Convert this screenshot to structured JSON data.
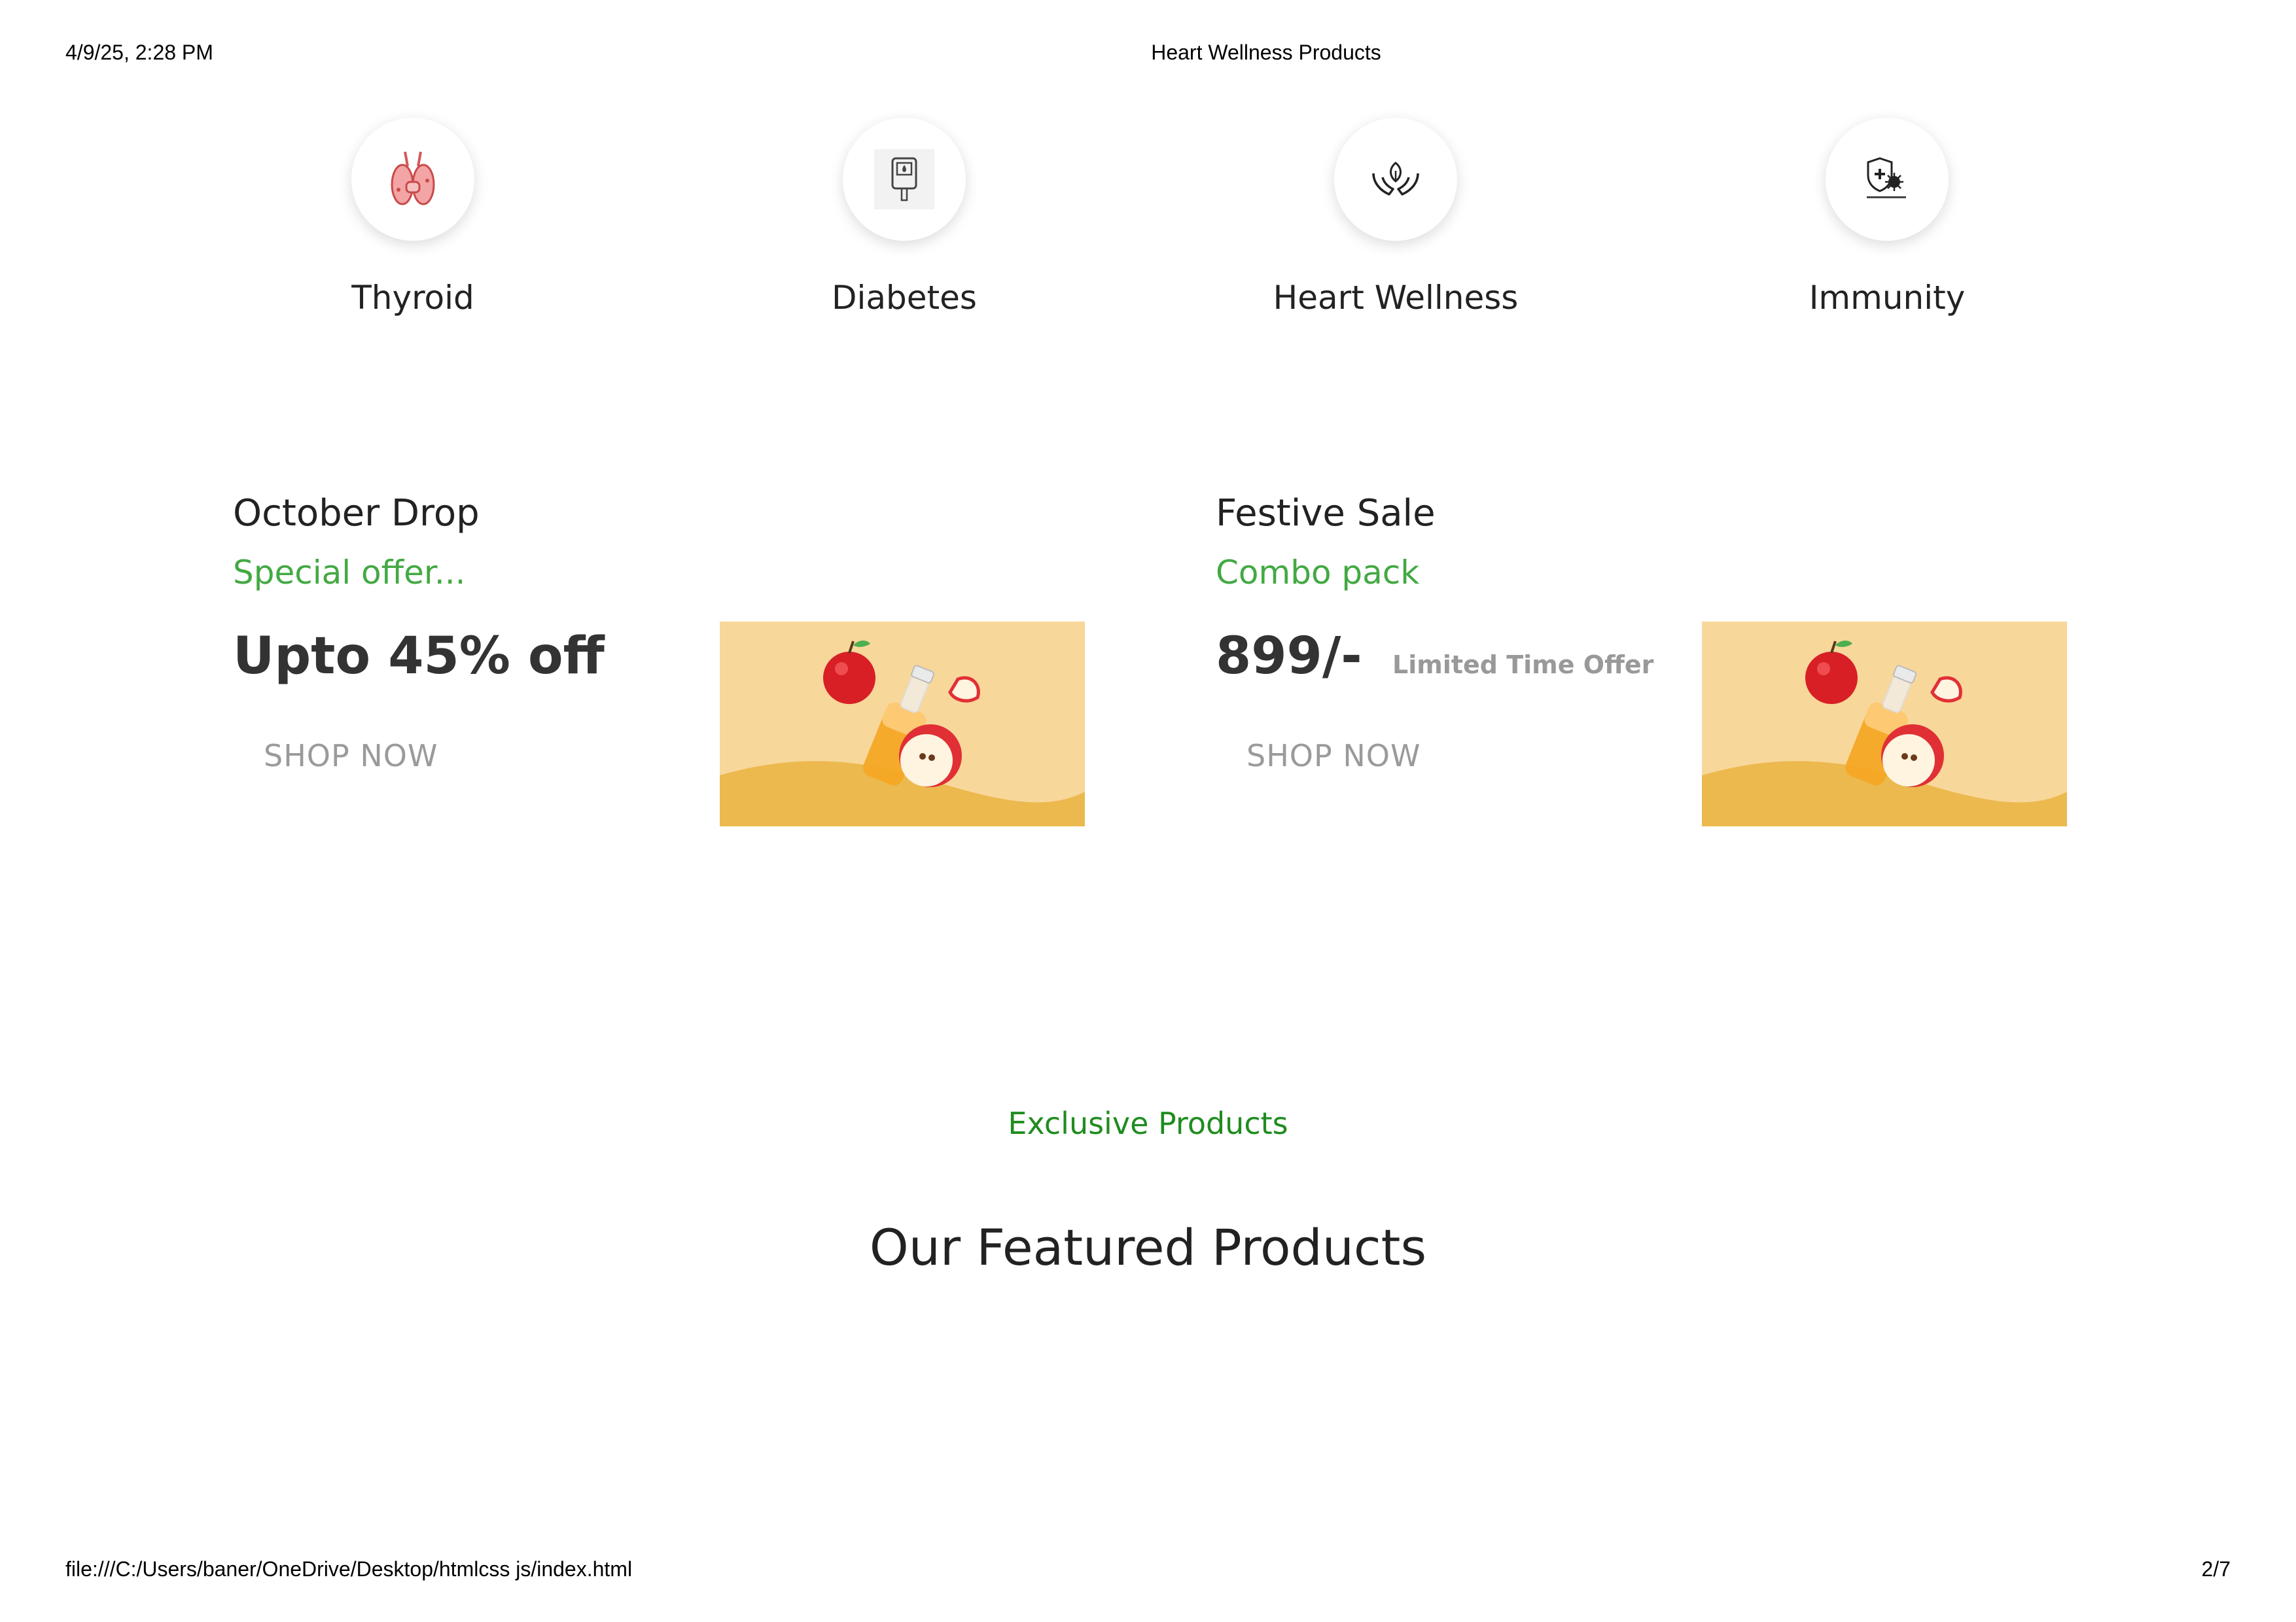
{
  "print_header": {
    "datetime": "4/9/25, 2:28 PM",
    "doc_title": "Heart Wellness Products"
  },
  "categories": [
    {
      "label": "Thyroid",
      "icon": "thyroid-icon"
    },
    {
      "label": "Diabetes",
      "icon": "glucose-meter-icon"
    },
    {
      "label": "Heart Wellness",
      "icon": "hands-leaf-icon"
    },
    {
      "label": "Immunity",
      "icon": "shield-virus-icon"
    }
  ],
  "promos": [
    {
      "title": "October Drop",
      "subtitle": "Special offer...",
      "headline": "Upto 45% off",
      "note": "",
      "button": "SHOP NOW",
      "image": "apple-cider-bottle-image"
    },
    {
      "title": "Festive Sale",
      "subtitle": "Combo pack",
      "headline": "899/-",
      "note": "Limited Time Offer",
      "button": "SHOP NOW",
      "image": "apple-cider-bottle-image"
    }
  ],
  "featured": {
    "eyebrow": "Exclusive Products",
    "heading": "Our Featured Products"
  },
  "print_footer": {
    "url": "file:///C:/Users/baner/OneDrive/Desktop/htmlcss js/index.html",
    "page": "2/7"
  },
  "colors": {
    "accent_green": "#43a943",
    "eyebrow_green": "#1f8c1f",
    "promo_bg": "#f8d79a",
    "promo_wave": "#ecb94f"
  }
}
